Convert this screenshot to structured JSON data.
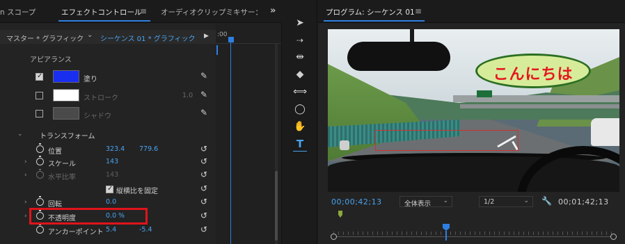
{
  "left_tabs": {
    "tab1": "n スコープ",
    "tab2": "エフェクトコントロール",
    "tab3": "オーディオクリップミキサー：",
    "menu_glyph": "≡",
    "overflow_glyph": "»"
  },
  "effect_controls": {
    "master": "マスター * グラフィック",
    "sequence": "シーケンス 01 * グラフィック",
    "timeline_time": ":00",
    "appearance_header": "アピアランス",
    "fill": {
      "label": "塗り",
      "color": "#1a2ef0",
      "checked": true
    },
    "stroke": {
      "label": "ストローク",
      "value": "1.0",
      "color": "#ffffff",
      "checked": false
    },
    "shadow": {
      "label": "シャドウ",
      "color": "#4a4a4a",
      "checked": false
    },
    "transform_header": "トランスフォーム",
    "position": {
      "label": "位置",
      "x": "323.4",
      "y": "779.6"
    },
    "scale": {
      "label": "スケール",
      "value": "143"
    },
    "scale_width": {
      "label": "水平比率",
      "value": "143"
    },
    "uniform_scale": {
      "label": "縦横比を固定",
      "checked": true
    },
    "rotation": {
      "label": "回転",
      "value": "0.0"
    },
    "opacity": {
      "label": "不透明度",
      "value": "0.0",
      "unit": "%"
    },
    "anchor": {
      "label": "アンカーポイント",
      "x": "5.4",
      "y": "-5.4"
    }
  },
  "tools": [
    "selection-tool",
    "track-select-tool",
    "ripple-edit-tool",
    "razor-tool",
    "slip-tool",
    "ellipse-tool",
    "hand-tool",
    "type-tool"
  ],
  "program": {
    "title": "プログラム: シーケンス 01",
    "menu_glyph": "≡",
    "overlay_text": "こんにちは",
    "timecode_current": "00;00;42;13",
    "zoom": "全体表示",
    "resolution": "1/2",
    "timecode_duration": "00;01;42;13"
  },
  "colors": {
    "accent": "#2f7fe2",
    "value_blue": "#4aa3f0",
    "highlight_red": "#e0141b",
    "bubble_text": "#e4171f",
    "bubble_fill": "#d7ec9a"
  }
}
